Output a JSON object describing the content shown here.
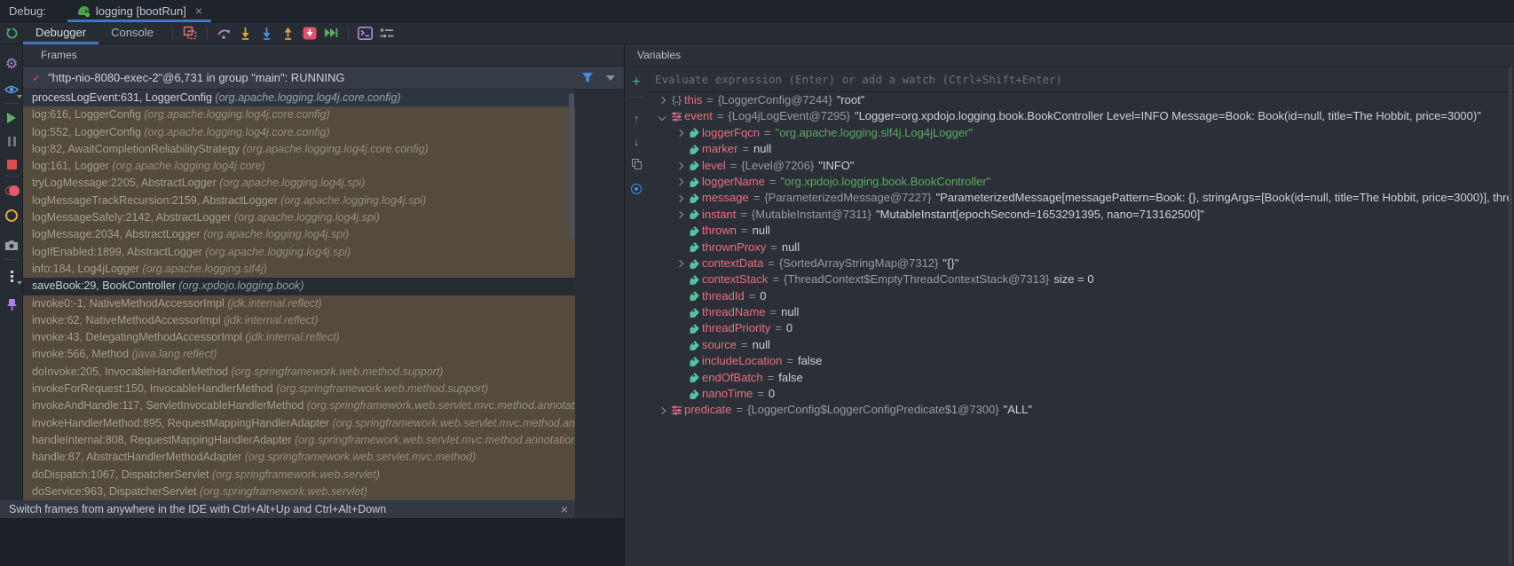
{
  "window": {
    "debug_label": "Debug:",
    "tab_label": "logging [bootRun]",
    "tab_close": "×",
    "tab_icon": "gradle-elephant-icon"
  },
  "toolbar": {
    "tabs": [
      {
        "label": "Debugger"
      },
      {
        "label": "Console"
      }
    ],
    "icons": [
      "layout-settings-icon",
      "step-over-icon",
      "step-into-icon",
      "force-step-into-icon",
      "step-out-icon",
      "reset-frame-icon",
      "run-to-cursor-icon",
      "evaluate-expression-icon",
      "view-options-icon"
    ]
  },
  "left_toolbar": {
    "icons": [
      "rerun-icon",
      "settings-gear-icon",
      "eye-icon",
      "resume-icon",
      "pause-icon",
      "stop-icon",
      "view-breakpoints-icon",
      "mute-breakpoints-icon",
      "thread-dump-camera-icon",
      "more-options-icon",
      "pin-icon"
    ]
  },
  "frames": {
    "header": "Frames",
    "thread_check": "✓",
    "thread_line": "\"http-nio-8080-exec-2\"@6,731 in group \"main\": RUNNING",
    "thread_icons": [
      "filter-threads-icon",
      "thread-dropdown-chevron-icon"
    ],
    "rows": [
      {
        "label": "processLogEvent:631, LoggerConfig",
        "pkg": "(org.apache.logging.log4j.core.config)",
        "variant": "selected"
      },
      {
        "label": "log:616, LoggerConfig",
        "pkg": "(org.apache.logging.log4j.core.config)",
        "variant": "library"
      },
      {
        "label": "log:552, LoggerConfig",
        "pkg": "(org.apache.logging.log4j.core.config)",
        "variant": "library"
      },
      {
        "label": "log:82, AwaitCompletionReliabilityStrategy",
        "pkg": "(org.apache.logging.log4j.core.config)",
        "variant": "library"
      },
      {
        "label": "log:161, Logger",
        "pkg": "(org.apache.logging.log4j.core)",
        "variant": "library"
      },
      {
        "label": "tryLogMessage:2205, AbstractLogger",
        "pkg": "(org.apache.logging.log4j.spi)",
        "variant": "library"
      },
      {
        "label": "logMessageTrackRecursion:2159, AbstractLogger",
        "pkg": "(org.apache.logging.log4j.spi)",
        "variant": "library"
      },
      {
        "label": "logMessageSafely:2142, AbstractLogger",
        "pkg": "(org.apache.logging.log4j.spi)",
        "variant": "library"
      },
      {
        "label": "logMessage:2034, AbstractLogger",
        "pkg": "(org.apache.logging.log4j.spi)",
        "variant": "library"
      },
      {
        "label": "logIfEnabled:1899, AbstractLogger",
        "pkg": "(org.apache.logging.log4j.spi)",
        "variant": "library"
      },
      {
        "label": "info:184, Log4jLogger",
        "pkg": "(org.apache.logging.slf4j)",
        "variant": "library"
      },
      {
        "label": "saveBook:29, BookController",
        "pkg": "(org.xpdojo.logging.book)",
        "variant": "user"
      },
      {
        "label": "invoke0:-1, NativeMethodAccessorImpl",
        "pkg": "(jdk.internal.reflect)",
        "variant": "library"
      },
      {
        "label": "invoke:62, NativeMethodAccessorImpl",
        "pkg": "(jdk.internal.reflect)",
        "variant": "library"
      },
      {
        "label": "invoke:43, DelegatingMethodAccessorImpl",
        "pkg": "(jdk.internal.reflect)",
        "variant": "library"
      },
      {
        "label": "invoke:566, Method",
        "pkg": "(java.lang.reflect)",
        "variant": "library"
      },
      {
        "label": "doInvoke:205, InvocableHandlerMethod",
        "pkg": "(org.springframework.web.method.support)",
        "variant": "library"
      },
      {
        "label": "invokeForRequest:150, InvocableHandlerMethod",
        "pkg": "(org.springframework.web.method.support)",
        "variant": "library"
      },
      {
        "label": "invokeAndHandle:117, ServletInvocableHandlerMethod",
        "pkg": "(org.springframework.web.servlet.mvc.method.annotation)",
        "variant": "library"
      },
      {
        "label": "invokeHandlerMethod:895, RequestMappingHandlerAdapter",
        "pkg": "(org.springframework.web.servlet.mvc.method.annotation)",
        "variant": "library"
      },
      {
        "label": "handleInternal:808, RequestMappingHandlerAdapter",
        "pkg": "(org.springframework.web.servlet.mvc.method.annotation)",
        "variant": "library"
      },
      {
        "label": "handle:87, AbstractHandlerMethodAdapter",
        "pkg": "(org.springframework.web.servlet.mvc.method)",
        "variant": "library"
      },
      {
        "label": "doDispatch:1067, DispatcherServlet",
        "pkg": "(org.springframework.web.servlet)",
        "variant": "library"
      },
      {
        "label": "doService:963, DispatcherServlet",
        "pkg": "(org.springframework.web.servlet)",
        "variant": "library"
      }
    ],
    "banner": {
      "text": "Switch frames from anywhere in the IDE with Ctrl+Alt+Up and Ctrl+Alt+Down",
      "close": "×"
    }
  },
  "variables": {
    "header": "Variables",
    "evaluate_placeholder": "Evaluate expression (Enter) or add a watch (Ctrl+Shift+Enter)",
    "eq": "=",
    "minibar_icons": [
      "add-watch-icon",
      "move-up-icon",
      "move-down-icon",
      "duplicate-icon",
      "watch-eye-icon"
    ],
    "rows": [
      {
        "name": "this",
        "depth": 0,
        "exp": "right",
        "icon": "braces",
        "ref": "{LoggerConfig@7244}",
        "value": "\"root\"",
        "kind": "plain"
      },
      {
        "name": "event",
        "depth": 0,
        "exp": "down",
        "icon": "sliders",
        "ref": "{Log4jLogEvent@7295}",
        "value": "\"Logger=org.xpdojo.logging.book.BookController Level=INFO Message=Book: Book(id=null, title=The Hobbit, price=3000)\"",
        "kind": "plain"
      },
      {
        "name": "loggerFqcn",
        "depth": 1,
        "exp": "right",
        "icon": "tag",
        "ref": "",
        "value": "\"org.apache.logging.slf4j.Log4jLogger\"",
        "kind": "string"
      },
      {
        "name": "marker",
        "depth": 1,
        "exp": "",
        "icon": "tag",
        "ref": "",
        "value": "null",
        "kind": "plain"
      },
      {
        "name": "level",
        "depth": 1,
        "exp": "right",
        "icon": "tag",
        "ref": "{Level@7206}",
        "value": "\"INFO\"",
        "kind": "plain"
      },
      {
        "name": "loggerName",
        "depth": 1,
        "exp": "right",
        "icon": "tag",
        "ref": "",
        "value": "\"org.xpdojo.logging.book.BookController\"",
        "kind": "string"
      },
      {
        "name": "message",
        "depth": 1,
        "exp": "right",
        "icon": "tag",
        "ref": "{ParameterizedMessage@7227}",
        "value": "\"ParameterizedMessage[messagePattern=Book: {}, stringArgs=[Book(id=null, title=The Hobbit, price=3000)], throwable=null]\"",
        "kind": "plain"
      },
      {
        "name": "instant",
        "depth": 1,
        "exp": "right",
        "icon": "tag",
        "ref": "{MutableInstant@7311}",
        "value": "\"MutableInstant[epochSecond=1653291395, nano=713162500]\"",
        "kind": "plain"
      },
      {
        "name": "thrown",
        "depth": 1,
        "exp": "",
        "icon": "tag",
        "ref": "",
        "value": "null",
        "kind": "plain"
      },
      {
        "name": "thrownProxy",
        "depth": 1,
        "exp": "",
        "icon": "tag",
        "ref": "",
        "value": "null",
        "kind": "plain"
      },
      {
        "name": "contextData",
        "depth": 1,
        "exp": "right",
        "icon": "tag",
        "ref": "{SortedArrayStringMap@7312}",
        "value": "\"{}\"",
        "kind": "plain"
      },
      {
        "name": "contextStack",
        "depth": 1,
        "exp": "",
        "icon": "tag",
        "ref": "{ThreadContext$EmptyThreadContextStack@7313}",
        "value": "size = 0",
        "kind": "plain"
      },
      {
        "name": "threadId",
        "depth": 1,
        "exp": "",
        "icon": "tag",
        "ref": "",
        "value": "0",
        "kind": "plain"
      },
      {
        "name": "threadName",
        "depth": 1,
        "exp": "",
        "icon": "tag",
        "ref": "",
        "value": "null",
        "kind": "plain"
      },
      {
        "name": "threadPriority",
        "depth": 1,
        "exp": "",
        "icon": "tag",
        "ref": "",
        "value": "0",
        "kind": "plain"
      },
      {
        "name": "source",
        "depth": 1,
        "exp": "",
        "icon": "tag",
        "ref": "",
        "value": "null",
        "kind": "plain"
      },
      {
        "name": "includeLocation",
        "depth": 1,
        "exp": "",
        "icon": "tag",
        "ref": "",
        "value": "false",
        "kind": "plain"
      },
      {
        "name": "endOfBatch",
        "depth": 1,
        "exp": "",
        "icon": "tag",
        "ref": "",
        "value": "false",
        "kind": "plain"
      },
      {
        "name": "nanoTime",
        "depth": 1,
        "exp": "",
        "icon": "tag",
        "ref": "",
        "value": "0",
        "kind": "plain"
      },
      {
        "name": "predicate",
        "depth": 0,
        "exp": "right",
        "icon": "sliders",
        "ref": "{LoggerConfig$LoggerConfigPredicate$1@7300}",
        "value": "\"ALL\"",
        "kind": "plain"
      }
    ]
  },
  "colors": {
    "accent_blue": "#3d77c2",
    "library_frame_bg": "#544a3d",
    "selected_frame_bg": "#2f3540",
    "variable_name": "#ec6f7d",
    "string_value": "#5cab60",
    "tag_icon": "#52c3a4",
    "panel_bg": "#2b2f38"
  }
}
